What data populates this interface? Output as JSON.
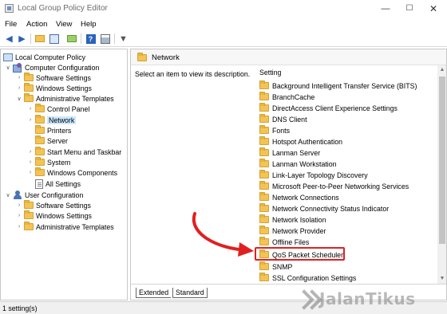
{
  "window": {
    "title": "Local Group Policy Editor",
    "minimize": "—",
    "maximize": "☐",
    "close": "✕"
  },
  "menu": [
    "File",
    "Action",
    "View",
    "Help"
  ],
  "tree": {
    "items": [
      {
        "label": "Local Computer Policy",
        "icon": "computer-icon",
        "expanded": true
      },
      {
        "label": "Computer Configuration",
        "icon": "computer-config-icon",
        "expanded": true
      },
      {
        "label": "Software Settings",
        "icon": "folder-icon",
        "expander": ">"
      },
      {
        "label": "Windows Settings",
        "icon": "folder-icon",
        "expander": ">"
      },
      {
        "label": "Administrative Templates",
        "icon": "folder-icon",
        "expander": "v"
      },
      {
        "label": "Control Panel",
        "icon": "folder-icon",
        "expander": ">"
      },
      {
        "label": "Network",
        "icon": "folder-icon",
        "expander": ">",
        "selected": true
      },
      {
        "label": "Printers",
        "icon": "folder-icon",
        "expander": ""
      },
      {
        "label": "Server",
        "icon": "folder-icon",
        "expander": ""
      },
      {
        "label": "Start Menu and Taskbar",
        "icon": "folder-icon",
        "expander": ">"
      },
      {
        "label": "System",
        "icon": "folder-icon",
        "expander": ">"
      },
      {
        "label": "Windows Components",
        "icon": "folder-icon",
        "expander": ">"
      },
      {
        "label": "All Settings",
        "icon": "document-icon",
        "expander": ""
      },
      {
        "label": "User Configuration",
        "icon": "user-config-icon",
        "expander": "v"
      },
      {
        "label": "Software Settings",
        "icon": "folder-icon",
        "expander": ">"
      },
      {
        "label": "Windows Settings",
        "icon": "folder-icon",
        "expander": ">"
      },
      {
        "label": "Administrative Templates",
        "icon": "folder-icon",
        "expander": ">"
      }
    ]
  },
  "main": {
    "header_title": "Network",
    "description": "Select an item to view its description.",
    "column_header": "Setting",
    "settings": [
      "Background Intelligent Transfer Service (BITS)",
      "BranchCache",
      "DirectAccess Client Experience Settings",
      "DNS Client",
      "Fonts",
      "Hotspot Authentication",
      "Lanman Server",
      "Lanman Workstation",
      "Link-Layer Topology Discovery",
      "Microsoft Peer-to-Peer Networking Services",
      "Network Connections",
      "Network Connectivity Status Indicator",
      "Network Isolation",
      "Network Provider",
      "Offline Files",
      "QoS Packet Scheduler",
      "SNMP",
      "SSL Configuration Settings"
    ],
    "highlighted_setting": "QoS Packet Scheduler",
    "tabs": [
      "Extended",
      "Standard"
    ]
  },
  "status": {
    "text": "1 setting(s)"
  },
  "watermark": {
    "text": "JalanTikus"
  },
  "colors": {
    "selection": "#cce8ff",
    "folder": "#f3c455",
    "annotation_red": "#e02020",
    "toolbar_blue": "#2a62b9"
  }
}
